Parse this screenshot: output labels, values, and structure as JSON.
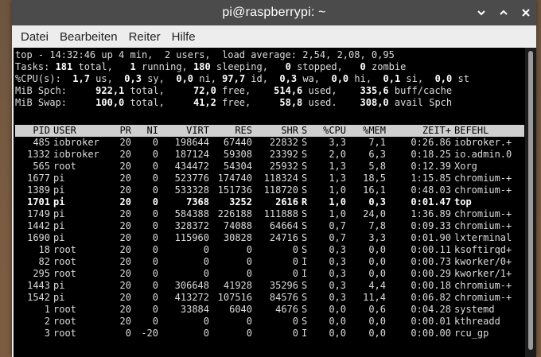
{
  "window": {
    "title": "pi@raspberrypi: ~"
  },
  "menu": [
    "Datei",
    "Bearbeiten",
    "Reiter",
    "Hilfe"
  ],
  "summary": {
    "top_line": "top - 14:32:46 up 4 min,  2 users,  load average: 2,54, 2,08, 0,95",
    "tasks": {
      "prefix": "Tasks: ",
      "total": "181",
      "t1": " total,   ",
      "running": "1",
      "t2": " running, ",
      "sleeping": "180",
      "t3": " sleeping,   ",
      "stopped": "0",
      "t4": " stopped,   ",
      "zombie": "0",
      "t5": " zombie"
    },
    "cpu": {
      "prefix": "%CPU(s):  ",
      "us": "1,7",
      "t1": " us,  ",
      "sy": "0,3",
      "t2": " sy,  ",
      "ni": "0,0",
      "t3": " ni, ",
      "id": "97,7",
      "t4": " id,  ",
      "wa": "0,3",
      "t5": " wa,  ",
      "hi": "0,0",
      "t6": " hi,  ",
      "si": "0,1",
      "t7": " si,  ",
      "st": "0,0",
      "t8": " st"
    },
    "mem": {
      "prefix": "MiB Spch:     ",
      "total": "922,1",
      "t1": " total,     ",
      "free": "72,0",
      "t2": " free,    ",
      "used": "514,6",
      "t3": " used,    ",
      "buff": "335,6",
      "t4": " buff/cache"
    },
    "swap": {
      "prefix": "MiB Swap:     ",
      "total": "100,0",
      "t1": " total,     ",
      "free": "41,2",
      "t2": " free,     ",
      "used": "58,8",
      "t3": " used.    ",
      "avail": "308,0",
      "t4": " avail Spch"
    }
  },
  "columns": [
    "PID",
    "USER",
    "PR",
    "NI",
    "VIRT",
    "RES",
    "SHR",
    "S",
    "%CPU",
    "%MEM",
    "ZEIT+",
    "BEFEHL"
  ],
  "processes": [
    [
      "485",
      "iobroker",
      "20",
      "0",
      "198644",
      "67440",
      "22832",
      "S",
      "3,3",
      "7,1",
      "0:26.86",
      "iobroker.+"
    ],
    [
      "1332",
      "iobroker",
      "20",
      "0",
      "187124",
      "59308",
      "23392",
      "S",
      "2,0",
      "6,3",
      "0:18.25",
      "io.admin.0"
    ],
    [
      "565",
      "root",
      "20",
      "0",
      "434472",
      "54304",
      "25932",
      "S",
      "1,3",
      "5,8",
      "0:12.39",
      "Xorg"
    ],
    [
      "1677",
      "pi",
      "20",
      "0",
      "523776",
      "174740",
      "118324",
      "S",
      "1,3",
      "18,5",
      "1:15.85",
      "chromium-+"
    ],
    [
      "1389",
      "pi",
      "20",
      "0",
      "533328",
      "151736",
      "118720",
      "S",
      "1,0",
      "16,1",
      "0:48.03",
      "chromium-+"
    ],
    [
      "1701",
      "pi",
      "20",
      "0",
      "7368",
      "3252",
      "2616",
      "R",
      "1,0",
      "0,3",
      "0:01.47",
      "top"
    ],
    [
      "1749",
      "pi",
      "20",
      "0",
      "584388",
      "226188",
      "111888",
      "S",
      "1,0",
      "24,0",
      "1:36.89",
      "chromium-+"
    ],
    [
      "1442",
      "pi",
      "20",
      "0",
      "328372",
      "74088",
      "64664",
      "S",
      "0,7",
      "7,8",
      "0:09.33",
      "chromium-+"
    ],
    [
      "1690",
      "pi",
      "20",
      "0",
      "115960",
      "30828",
      "24716",
      "S",
      "0,7",
      "3,3",
      "0:01.90",
      "lxterminal"
    ],
    [
      "18",
      "root",
      "20",
      "0",
      "0",
      "0",
      "0",
      "S",
      "0,3",
      "0,0",
      "0:00.11",
      "ksoftirqd+"
    ],
    [
      "82",
      "root",
      "20",
      "0",
      "0",
      "0",
      "0",
      "I",
      "0,3",
      "0,0",
      "0:00.73",
      "kworker/0+"
    ],
    [
      "295",
      "root",
      "20",
      "0",
      "0",
      "0",
      "0",
      "I",
      "0,3",
      "0,0",
      "0:00.29",
      "kworker/1+"
    ],
    [
      "1443",
      "pi",
      "20",
      "0",
      "306648",
      "41928",
      "35296",
      "S",
      "0,3",
      "4,4",
      "0:00.18",
      "chromium-+"
    ],
    [
      "1542",
      "pi",
      "20",
      "0",
      "413272",
      "107516",
      "84576",
      "S",
      "0,3",
      "11,4",
      "0:06.82",
      "chromium-+"
    ],
    [
      "1",
      "root",
      "20",
      "0",
      "33884",
      "6040",
      "4676",
      "S",
      "0,0",
      "0,6",
      "0:04.28",
      "systemd"
    ],
    [
      "2",
      "root",
      "20",
      "0",
      "0",
      "0",
      "0",
      "S",
      "0,0",
      "0,0",
      "0:00.01",
      "kthreadd"
    ],
    [
      "3",
      "root",
      "0",
      "-20",
      "0",
      "0",
      "0",
      "I",
      "0,0",
      "0,0",
      "0:00.00",
      "rcu_gp"
    ]
  ],
  "highlight_row": 5
}
